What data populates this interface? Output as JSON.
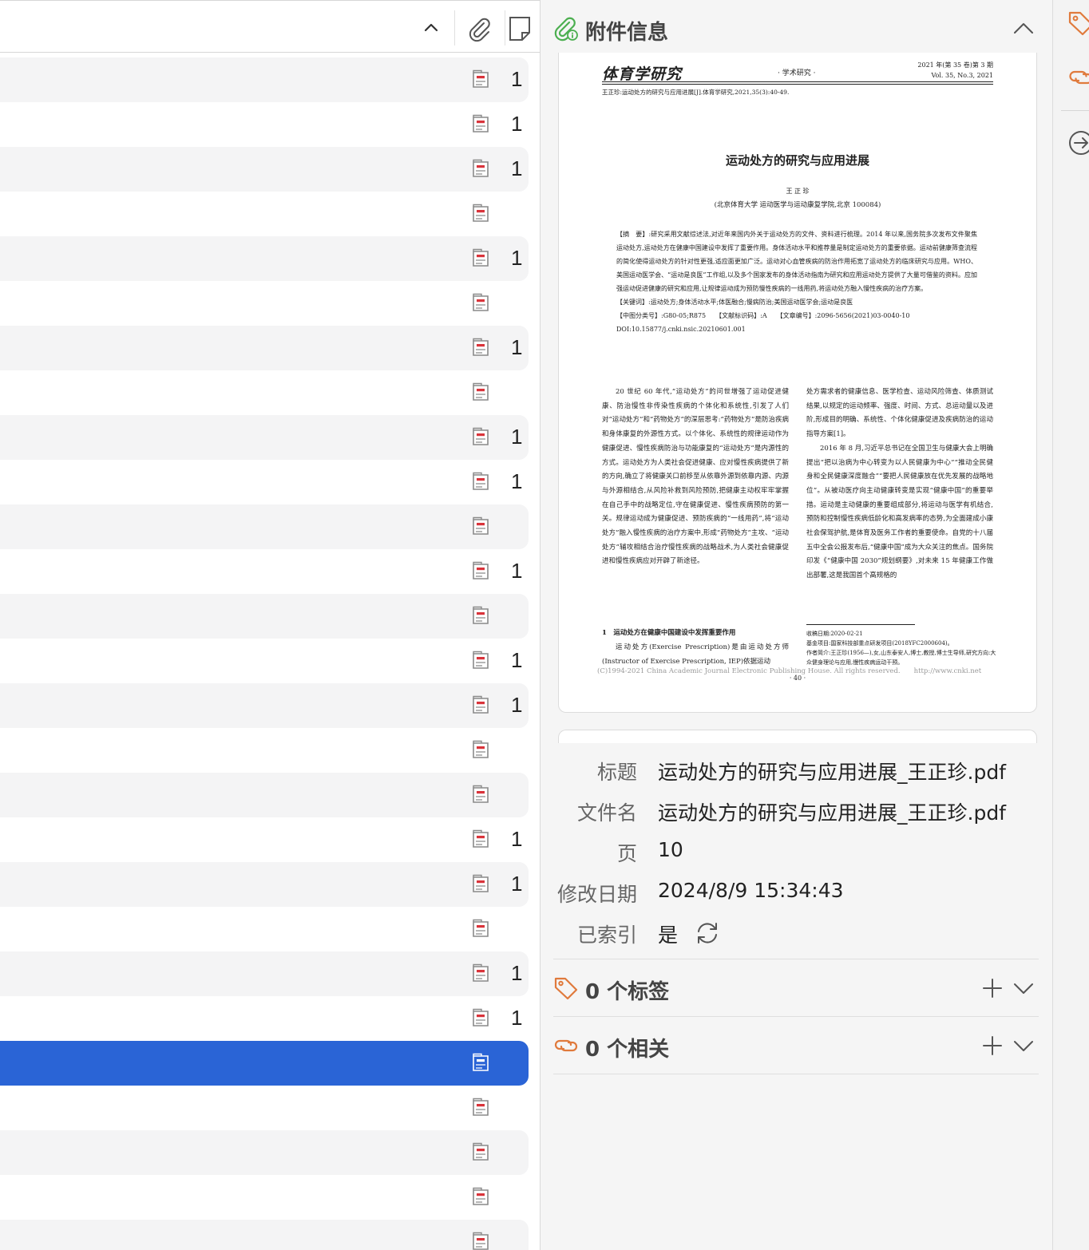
{
  "items_list": {
    "rows": [
      {
        "notes": "1",
        "alt": true
      },
      {
        "notes": "1",
        "alt": false
      },
      {
        "notes": "1",
        "alt": true
      },
      {
        "notes": "",
        "alt": false
      },
      {
        "notes": "1",
        "alt": true
      },
      {
        "notes": "",
        "alt": false
      },
      {
        "notes": "1",
        "alt": true
      },
      {
        "notes": "",
        "alt": false
      },
      {
        "notes": "1",
        "alt": true
      },
      {
        "notes": "1",
        "alt": false
      },
      {
        "notes": "",
        "alt": true
      },
      {
        "notes": "1",
        "alt": false
      },
      {
        "notes": "",
        "alt": true
      },
      {
        "notes": "1",
        "alt": false
      },
      {
        "notes": "1",
        "alt": true
      },
      {
        "notes": "",
        "alt": false
      },
      {
        "notes": "",
        "alt": true
      },
      {
        "notes": "1",
        "alt": false
      },
      {
        "notes": "1",
        "alt": true
      },
      {
        "notes": "",
        "alt": false
      },
      {
        "notes": "1",
        "alt": true
      },
      {
        "notes": "1",
        "alt": false
      },
      {
        "notes": "",
        "alt": true,
        "selected": true
      },
      {
        "notes": "",
        "alt": false
      },
      {
        "notes": "",
        "alt": true
      },
      {
        "notes": "",
        "alt": false
      },
      {
        "notes": "",
        "alt": true
      }
    ]
  },
  "attachment_info": {
    "section_title": "附件信息",
    "preview": {
      "journal_name": "体育学研究",
      "journal_section": "· 学术研究 ·",
      "issue_cn": "2021 年(第 35 卷)第 3 期",
      "issue_en": "Vol. 35, No.3, 2021",
      "citation": "王正珍:运动处方的研究与应用进展[J].体育学研究,2021,35(3):40-49.",
      "article_title": "运动处方的研究与应用进展",
      "author": "王 正 珍",
      "affiliation": "(北京体育大学 运动医学与运动康复学院,北京 100084)",
      "abstract": "【摘　要】:研究采用文献综述法,对近年来国内外关于运动处方的文件、资料进行梳理。2014 年以来,国务院多次发布文件聚焦运动处方,运动处方在健康中国建设中发挥了重要作用。身体活动水平和推荐量是制定运动处方的重要依据。运动前健康筛查流程的简化使得运动处方的针对性更强,适应面更加广泛。运动对心血管疾病的防治作用拓宽了运动处方的临床研究与应用。WHO、美国运动医学会、“运动是良医”工作组,以及多个国家发布的身体活动指南为研究和应用运动处方提供了大量可借鉴的资料。应加强运动促进健康的研究和应用,让规律运动成为预防慢性疾病的一线用药,将运动处方融入慢性疾病的治疗方案。",
      "keywords": "【关键词】:运动处方;身体活动水平;体医融合;慢病防治;美国运动医学会;运动是良医",
      "classification": "【中图分类号】:G80-05;R875　　【文献标识码】:A　　【文章编号】:2096-5656(2021)03-0040-10",
      "doi": "DOI:10.15877/j.cnki.nsic.20210601.001",
      "body_left": "20 世纪 60 年代,“运动处方”的问世增强了运动促进健康、防治慢性非传染性疾病的个体化和系统性,引发了人们对“运动处方”和“药物处方”的深层思考:“药物处方”是防治疾病和身体康复的外源性方式。以个体化、系统性的规律运动作为健康促进、慢性疾病防治与功能康复的“运动处方”是内源性的方式。运动处方为人类社会促进健康、应对慢性疾病提供了新的方向,确立了将健康关口前移至从依靠外源到依靠内源、内源与外源相结合,从风险补救到风险预防,把健康主动权牢牢掌握在自己手中的战略定位,守在健康促进、慢性疾病预防的第一关。规律运动成为健康促进、预防疾病的“一线用药”,将“运动处方”融入慢性疾病的治疗方案中,形成“药物处方”主攻、“运动处方”辅攻相结合治疗慢性疾病的战略战术,为人类社会健康促进和慢性疾病应对开辟了新途径。",
      "body_right_1": "处方需求者的健康信息、医学检查、运动风险筛查、体质测试结果,以规定的运动频率、强度、时间、方式、总运动量以及进阶,形成目的明确、系统性、个体化健康促进及疾病防治的运动指导方案[1]。",
      "body_right_2": "2016 年 8 月,习近平总书记在全国卫生与健康大会上明确提出“把以治病为中心转变为以人民健康为中心”“推动全民健身和全民健康深度融合”“要把人民健康放在优先发展的战略地位”。从被动医疗向主动健康转变是实现“健康中国”的重要举措。运动是主动健康的重要组成部分,将运动与医学有机结合,预防和控制慢性疾病低龄化和高发病率的态势,为全面建成小康社会保驾护航,是体育及医务工作者的重要使命。自党的十八届五中全会公报发布后,“健康中国”成为大众关注的焦点。国务院印发《“健康中国 2030”规划纲要》,对未来 15 年健康工作做出部署,这是我国首个高规格的",
      "section_heading": "1　运动处方在健康中国建设中发挥重要作用",
      "body_left_2": "运动处方(Exercise Prescription)是由运动处方师(Instructor of Exercise Prescription, IEP)依据运动",
      "footnote_1": "收稿日期:2020-02-21",
      "footnote_2": "基金项目:国家科技部重点研发项目(2018YFC2000604)。",
      "footnote_3": "作者简介:王正珍(1956—),女,山东泰安人,博士,教授,博士生导师,研究方向:大众健身理论与应用,慢性疾病运动干预。",
      "copyright": "(C)1994-2021 China Academic Journal Electronic Publishing House. All rights reserved.　　http://www.cnki.net",
      "page_number": "· 40 ·"
    },
    "fields": {
      "title_label": "标题",
      "title_value": "运动处方的研究与应用进展_王正珍.pdf",
      "filename_label": "文件名",
      "filename_value": "运动处方的研究与应用进展_王正珍.pdf",
      "pages_label": "页",
      "pages_value": "10",
      "modified_label": "修改日期",
      "modified_value": "2024/8/9 15:34:43",
      "indexed_label": "已索引",
      "indexed_value": "是"
    }
  },
  "tags_section": {
    "title": "0 个标签"
  },
  "related_section": {
    "title": "0 个相关"
  },
  "colors": {
    "selection": "#2a64d6",
    "attachment_icon": "#4caf50",
    "tag_icon": "#e07a3c",
    "pdf_red": "#d9343b"
  }
}
